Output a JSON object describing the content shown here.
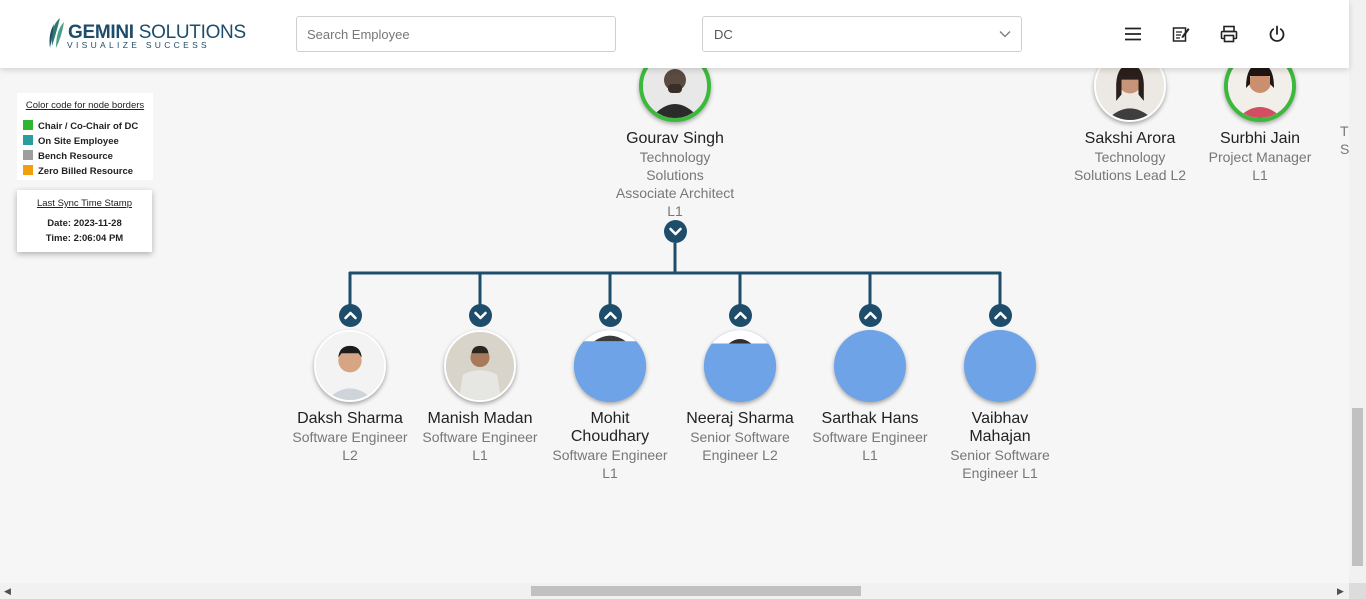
{
  "header": {
    "logo_title_bold": "GEMINI",
    "logo_title_rest": " SOLUTIONS",
    "logo_tagline": "VISUALIZE SUCCESS",
    "search_placeholder": "Search Employee",
    "dc_select_value": "DC",
    "icons": [
      "menu-icon",
      "edit-note-icon",
      "print-icon",
      "power-icon"
    ]
  },
  "legend": {
    "title": "Color code for node borders",
    "items": [
      {
        "label": "Chair / Co-Chair of DC",
        "color": "#2fb62f"
      },
      {
        "label": "On Site Employee",
        "color": "#2a9d9d"
      },
      {
        "label": "Bench Resource",
        "color": "#9e9e9e"
      },
      {
        "label": "Zero Billed Resource",
        "color": "#f0a00c"
      }
    ]
  },
  "sync": {
    "title": "Last Sync Time Stamp",
    "date": "Date: 2023-11-28",
    "time": "Time: 2:06:04 PM"
  },
  "colors": {
    "accent": "#1e4d6b",
    "chair_border": "#3cb93c",
    "placeholder_avatar": "#6ea3e8"
  },
  "top_nodes": [
    {
      "name": "Gourav Singh",
      "role_lines": [
        "Technology",
        "Solutions",
        "Associate Architect",
        "L1"
      ]
    },
    {
      "name": "Sakshi Arora",
      "role_lines": [
        "Technology",
        "Solutions Lead L2"
      ]
    },
    {
      "name": "Surbhi Jain",
      "role_lines": [
        "Project Manager",
        "L1"
      ]
    }
  ],
  "children": [
    {
      "name": "Daksh Sharma",
      "role_lines": [
        "Software Engineer",
        "L2"
      ]
    },
    {
      "name": "Manish Madan",
      "role_lines": [
        "Software Engineer",
        "L1"
      ]
    },
    {
      "name_lines": [
        "Mohit",
        "Choudhary"
      ],
      "role_lines": [
        "Software Engineer",
        "L1"
      ]
    },
    {
      "name": "Neeraj Sharma",
      "role_lines": [
        "Senior Software",
        "Engineer L2"
      ]
    },
    {
      "name": "Sarthak Hans",
      "role_lines": [
        "Software Engineer",
        "L1"
      ]
    },
    {
      "name_lines": [
        "Vaibhav",
        "Mahajan"
      ],
      "role_lines": [
        "Senior Software",
        "Engineer L1"
      ]
    }
  ],
  "edge_partial": {
    "role_fragment_1": "T",
    "role_fragment_2": "S"
  }
}
